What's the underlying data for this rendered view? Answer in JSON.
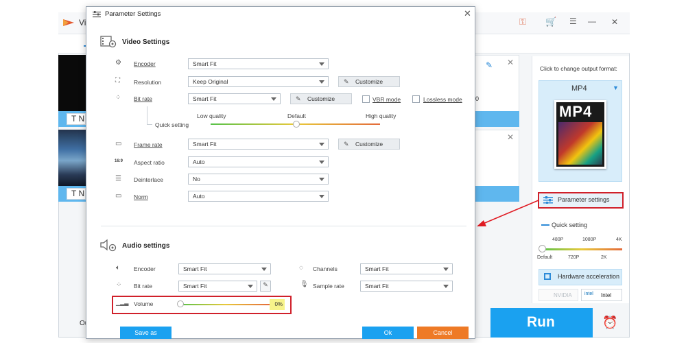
{
  "app": {
    "title": "Vi",
    "file1_label": "N",
    "file2_label": "N",
    "file1_partial": "0",
    "bottom_left_label": "Ou"
  },
  "right_panel": {
    "hint": "Click to change output format:",
    "format": "MP4",
    "format_image_text": "MP4",
    "param_button": "Parameter settings",
    "quick_setting": "Quick setting",
    "res_top": [
      "480P",
      "1080P",
      "4K"
    ],
    "res_bottom": [
      "Default",
      "720P",
      "2K"
    ],
    "hardware_button": "Hardware acceleration",
    "vendors": [
      "NVIDIA",
      "Intel"
    ],
    "run_button": "Run"
  },
  "dialog": {
    "title": "Parameter Settings",
    "video": {
      "section_title": "Video Settings",
      "encoder_label": "Encoder",
      "encoder_value": "Smart Fit",
      "resolution_label": "Resolution",
      "resolution_value": "Keep Original",
      "bitrate_label": "Bit rate",
      "bitrate_value": "Smart Fit",
      "customize_label": "Customize",
      "vbr_label": "VBR mode",
      "lossless_label": "Lossless mode",
      "quick_setting_label": "Quick setting",
      "quality_low": "Low quality",
      "quality_default": "Default",
      "quality_high": "High quality",
      "quality_level": 0.5,
      "framerate_label": "Frame rate",
      "framerate_value": "Smart Fit",
      "aspect_label": "Aspect ratio",
      "aspect_value": "Auto",
      "deinterlace_label": "Deinterlace",
      "deinterlace_value": "No",
      "norm_label": "Norm",
      "norm_value": "Auto",
      "aspect_icon_text": "16:9"
    },
    "audio": {
      "section_title": "Audio settings",
      "encoder_label": "Encoder",
      "encoder_value": "Smart Fit",
      "bitrate_label": "Bit rate",
      "bitrate_value": "Smart Fit",
      "channels_label": "Channels",
      "channels_value": "Smart Fit",
      "samplerate_label": "Sample rate",
      "samplerate_value": "Smart Fit",
      "volume_label": "Volume",
      "volume_value": "0%"
    },
    "save_as": "Save as",
    "ok": "Ok",
    "cancel": "Cancel"
  }
}
